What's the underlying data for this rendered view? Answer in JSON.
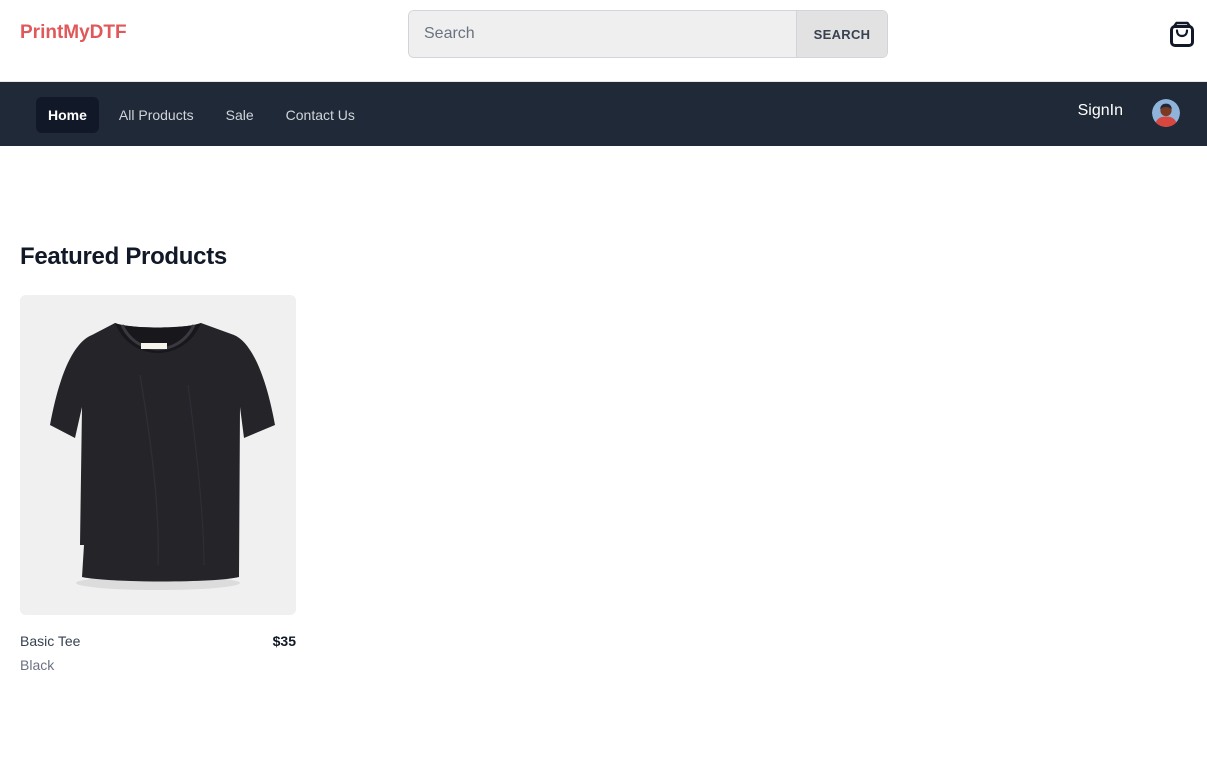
{
  "header": {
    "brand": "PrintMyDTF",
    "search": {
      "placeholder": "Search",
      "value": "",
      "button_label": "SEARCH"
    },
    "cart_icon": "shopping-bag-icon"
  },
  "nav": {
    "links": [
      {
        "label": "Home",
        "active": true
      },
      {
        "label": "All Products",
        "active": false
      },
      {
        "label": "Sale",
        "active": false
      },
      {
        "label": "Contact Us",
        "active": false
      }
    ],
    "signin_label": "SignIn",
    "avatar_icon": "user-avatar-icon"
  },
  "featured": {
    "title": "Featured Products",
    "products": [
      {
        "name": "Basic Tee",
        "price": "$35",
        "color": "Black",
        "image_icon": "black-t-shirt-image"
      }
    ]
  },
  "colors": {
    "brand": "#e0585a",
    "nav_bg": "#1f2937",
    "nav_active_bg": "#111827"
  }
}
